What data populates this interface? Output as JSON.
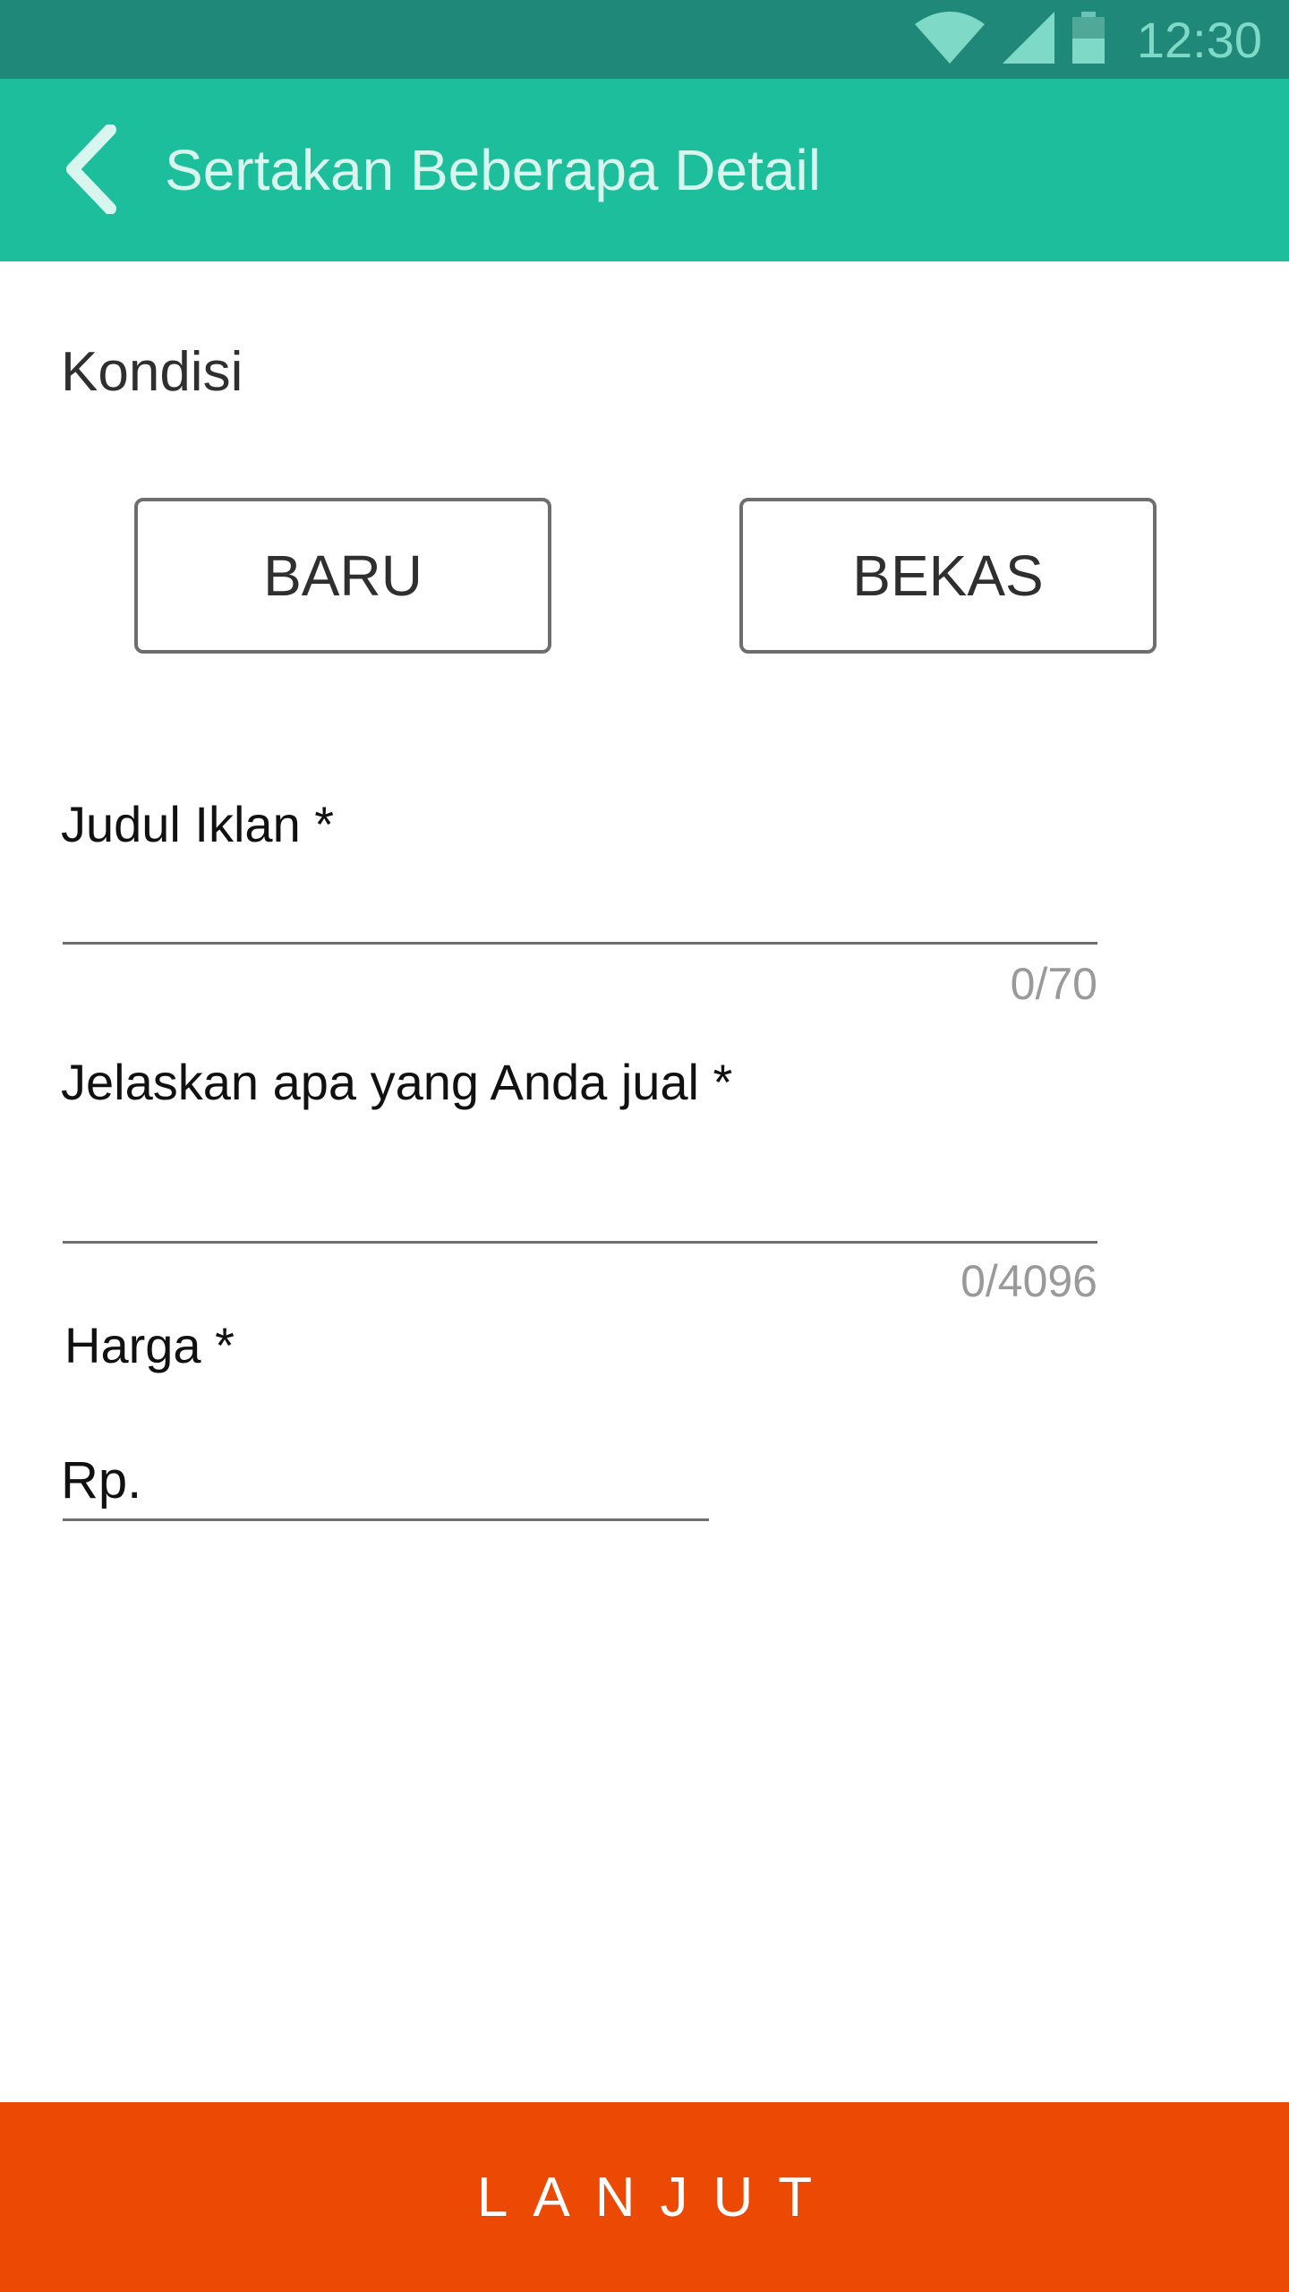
{
  "status_bar": {
    "time": "12:30",
    "icons": [
      "wifi-icon",
      "signal-icon",
      "battery-icon"
    ],
    "color": "#1f8878"
  },
  "app_bar": {
    "title": "Sertakan Beberapa Detail",
    "back_icon": "chevron-left-icon",
    "color": "#1dbe9c"
  },
  "condition": {
    "label": "Kondisi",
    "options": [
      {
        "label": "BARU"
      },
      {
        "label": "BEKAS"
      }
    ]
  },
  "form": {
    "title_field": {
      "label": "Judul Iklan *",
      "value": "",
      "counter": "0/70"
    },
    "description_field": {
      "label": "Jelaskan apa yang Anda jual *",
      "value": "",
      "counter": "0/4096"
    },
    "price_field": {
      "label": "Harga *",
      "prefix": "Rp.",
      "value": ""
    }
  },
  "footer": {
    "next_label": "LANJUT",
    "color": "#ec4a04"
  }
}
